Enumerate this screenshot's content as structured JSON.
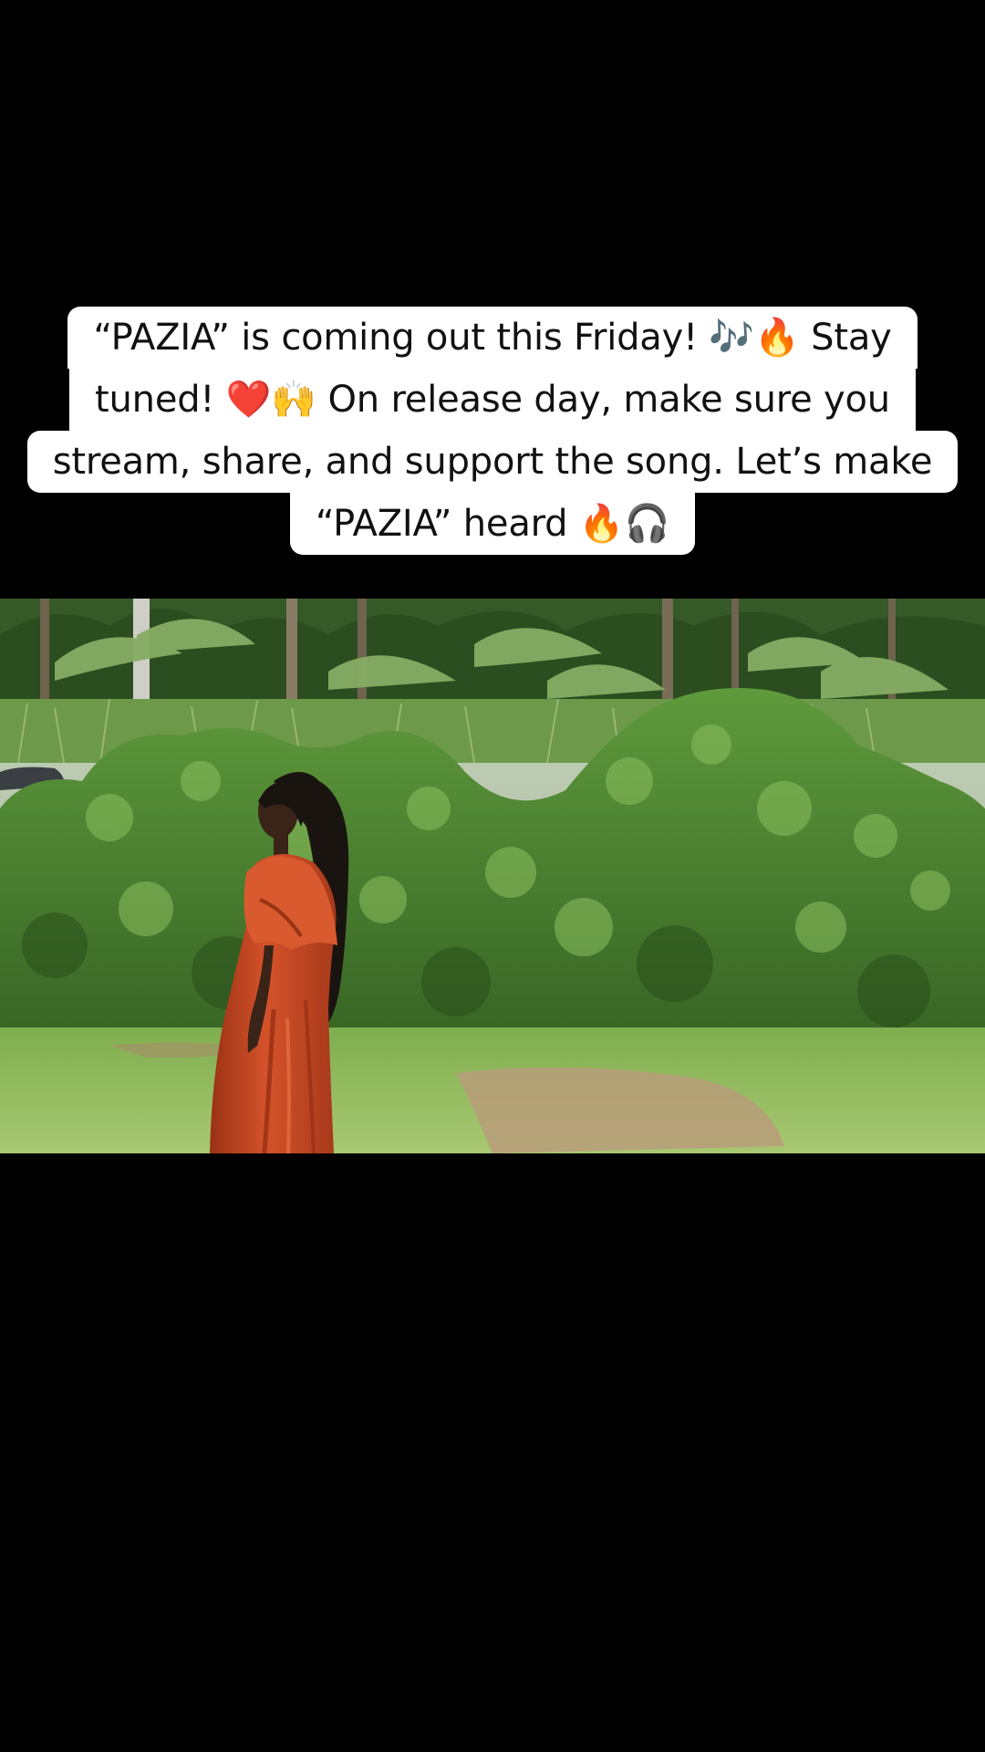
{
  "caption": {
    "lines": [
      "“PAZIA” is coming out this Friday! 🎶🔥 Stay",
      "tuned! ❤️🙌 On release day, make sure you",
      "stream, share, and support the song. Let’s make",
      "“PAZIA” heard 🔥🎧"
    ]
  },
  "video": {
    "scene": "woman-in-orange-dress-before-hedge",
    "colors": {
      "sky": "#b9c7b3",
      "tree_dark": "#2f4d22",
      "banana_leaf": "#7ea35c",
      "hedge_dark": "#2e5a1f",
      "hedge_mid": "#4f8a34",
      "hedge_light": "#7fb257",
      "grass": "#8fba5c",
      "dirt": "#b99c7a",
      "dress": "#c8471f",
      "dress_shadow": "#8f2b10",
      "skin": "#3a2418",
      "hair": "#1a1410"
    }
  }
}
